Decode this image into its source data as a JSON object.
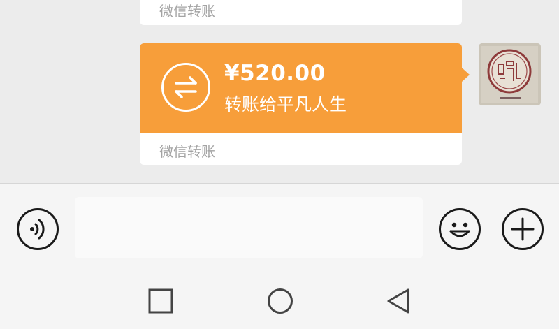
{
  "chat": {
    "previous_transfer": {
      "footer_label": "微信转账"
    },
    "transfer": {
      "amount": "¥520.00",
      "recipient_line": "转账给平凡人生",
      "footer_label": "微信转账",
      "accent_color": "#f79e3a"
    },
    "avatar": {
      "kind": "seal-stamp-image"
    }
  },
  "input_bar": {
    "voice_icon": "voice-icon",
    "text_input_value": "",
    "emoji_icon": "smiley-icon",
    "plus_icon": "plus-icon"
  },
  "nav_bar": {
    "buttons": [
      "recent-apps-icon",
      "home-icon",
      "back-icon"
    ]
  }
}
